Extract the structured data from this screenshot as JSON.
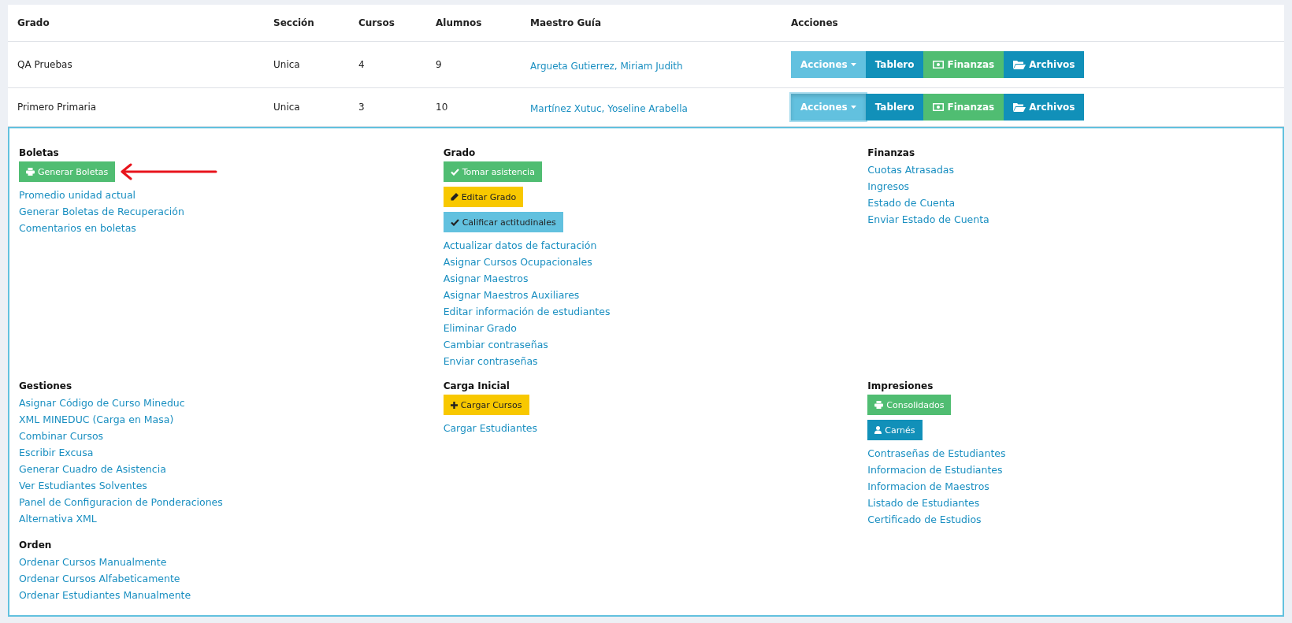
{
  "table": {
    "columns": [
      "Grado",
      "Sección",
      "Cursos",
      "Alumnos",
      "Maestro Guía",
      "Acciones"
    ],
    "rows": [
      {
        "grado": "QA Pruebas",
        "seccion": "Unica",
        "cursos": "4",
        "alumnos": "9",
        "maestro": "Argueta Gutierrez, Miriam Judith",
        "expanded": false,
        "buttons": [
          {
            "label": "Acciones",
            "kind": "dropdown"
          },
          {
            "label": "Tablero",
            "kind": "dashboard"
          },
          {
            "label": "Finanzas",
            "kind": "finance"
          },
          {
            "label": "Archivos",
            "kind": "files"
          }
        ]
      },
      {
        "grado": "Primero Primaria",
        "seccion": "Unica",
        "cursos": "3",
        "alumnos": "10",
        "maestro": "Martínez Xutuc, Yoseline Arabella",
        "expanded": true,
        "buttons": [
          {
            "label": "Acciones",
            "kind": "dropdown"
          },
          {
            "label": "Tablero",
            "kind": "dashboard"
          },
          {
            "label": "Finanzas",
            "kind": "finance"
          },
          {
            "label": "Archivos",
            "kind": "files"
          }
        ]
      }
    ]
  },
  "detail_panel": {
    "rows": [
      [
        [
          {
            "title": "Boletas",
            "items": [
              {
                "kind": "print",
                "label": "Generar Boletas",
                "annotated": true
              },
              {
                "kind": "link",
                "label": "Promedio unidad actual"
              },
              {
                "kind": "link",
                "label": "Generar Boletas de Recuperación"
              },
              {
                "kind": "link",
                "label": "Comentarios en boletas"
              }
            ]
          }
        ],
        [
          {
            "title": "Grado",
            "items": [
              {
                "kind": "attendance",
                "label": "Tomar asistencia"
              },
              {
                "kind": "edit",
                "label": "Editar Grado"
              },
              {
                "kind": "grading",
                "label": "Calificar actitudinales"
              },
              {
                "kind": "link",
                "label": "Actualizar datos de facturación"
              },
              {
                "kind": "link",
                "label": "Asignar Cursos Ocupacionales"
              },
              {
                "kind": "link",
                "label": "Asignar Maestros"
              },
              {
                "kind": "link",
                "label": "Asignar Maestros Auxiliares"
              },
              {
                "kind": "link",
                "label": "Editar información de estudiantes"
              },
              {
                "kind": "link",
                "label": "Eliminar Grado"
              },
              {
                "kind": "link",
                "label": "Cambiar contraseñas"
              },
              {
                "kind": "link",
                "label": "Enviar contraseñas"
              }
            ]
          }
        ],
        [
          {
            "title": "Finanzas",
            "items": [
              {
                "kind": "link",
                "label": "Cuotas Atrasadas"
              },
              {
                "kind": "link",
                "label": "Ingresos"
              },
              {
                "kind": "link",
                "label": "Estado de Cuenta"
              },
              {
                "kind": "link",
                "label": "Enviar Estado de Cuenta"
              }
            ]
          }
        ]
      ],
      [
        [
          {
            "title": "Gestiones",
            "items": [
              {
                "kind": "link",
                "label": "Asignar Código de Curso Mineduc"
              },
              {
                "kind": "link",
                "label": "XML MINEDUC (Carga en Masa)"
              },
              {
                "kind": "link",
                "label": "Combinar Cursos"
              },
              {
                "kind": "link",
                "label": "Escribir Excusa"
              },
              {
                "kind": "link",
                "label": "Generar Cuadro de Asistencia"
              },
              {
                "kind": "link",
                "label": "Ver Estudiantes Solventes"
              },
              {
                "kind": "link",
                "label": "Panel de Configuracion de Ponderaciones"
              },
              {
                "kind": "link",
                "label": "Alternativa XML"
              }
            ]
          },
          {
            "title": "Orden",
            "items": [
              {
                "kind": "link",
                "label": "Ordenar Cursos Manualmente"
              },
              {
                "kind": "link",
                "label": "Ordenar Cursos Alfabeticamente"
              },
              {
                "kind": "link",
                "label": "Ordenar Estudiantes Manualmente"
              }
            ]
          }
        ],
        [
          {
            "title": "Carga Inicial",
            "items": [
              {
                "kind": "upload",
                "label": "Cargar Cursos"
              },
              {
                "kind": "link",
                "label": "Cargar Estudiantes"
              }
            ]
          }
        ],
        [
          {
            "title": "Impresiones",
            "items": [
              {
                "kind": "print",
                "label": "Consolidados"
              },
              {
                "kind": "card",
                "label": "Carnés"
              },
              {
                "kind": "link",
                "label": "Contraseñas de Estudiantes"
              },
              {
                "kind": "link",
                "label": "Informacion de Estudiantes"
              },
              {
                "kind": "link",
                "label": "Informacion de Maestros"
              },
              {
                "kind": "link",
                "label": "Listado de Estudiantes"
              },
              {
                "kind": "link",
                "label": "Certificado de Estudios"
              }
            ]
          }
        ]
      ]
    ]
  }
}
